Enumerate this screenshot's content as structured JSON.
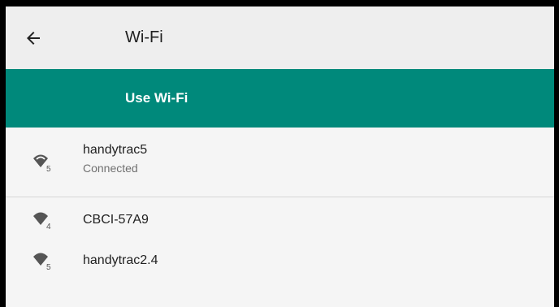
{
  "header": {
    "title": "Wi-Fi",
    "back_icon": "arrow-left-icon"
  },
  "toggle": {
    "label": "Use Wi-Fi"
  },
  "colors": {
    "accent": "#00897b",
    "icon": "#555555"
  },
  "networks": [
    {
      "ssid": "handytrac5",
      "status": "Connected",
      "band": "5",
      "icon": "wifi-signal-5ghz-icon"
    },
    {
      "ssid": "CBCI-57A9",
      "band": "4",
      "icon": "wifi-signal-2.4ghz-icon"
    },
    {
      "ssid": "handytrac2.4",
      "band": "5",
      "icon": "wifi-signal-5ghz-icon"
    }
  ]
}
